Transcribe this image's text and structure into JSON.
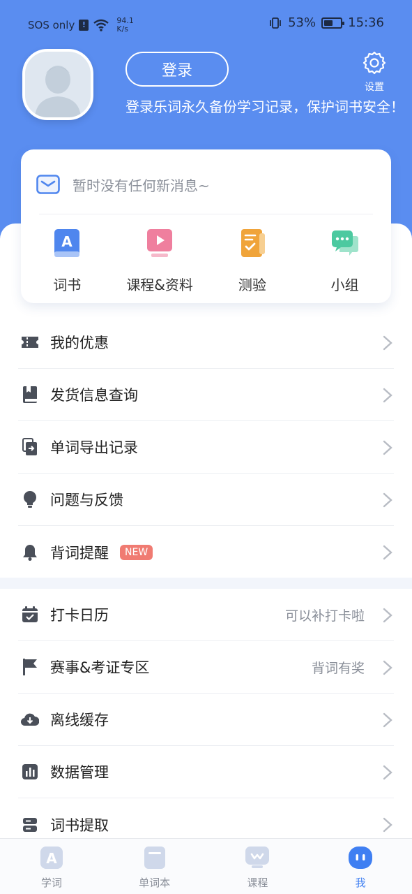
{
  "status_bar": {
    "carrier": "SOS only",
    "net_speed_value": "94.1",
    "net_speed_unit": "K/s",
    "battery": "53%",
    "battery_level": 0.53,
    "time": "15:36"
  },
  "header": {
    "login_label": "登录",
    "login_tip": "登录乐词永久备份学习记录，保护词书安全！",
    "settings_label": "设置"
  },
  "messages": {
    "empty_text": "暂时没有任何新消息~"
  },
  "quick_actions": [
    {
      "label": "词书",
      "icon": "word-book-icon",
      "color": "#4f86ee"
    },
    {
      "label": "课程&资料",
      "icon": "course-play-icon",
      "color": "#ef7f9e"
    },
    {
      "label": "测验",
      "icon": "quiz-icon",
      "color": "#f0a43a"
    },
    {
      "label": "小组",
      "icon": "group-chat-icon",
      "color": "#4cc9a0"
    }
  ],
  "menu_group_1": [
    {
      "label": "我的优惠",
      "icon": "ticket-icon"
    },
    {
      "label": "发货信息查询",
      "icon": "book-icon"
    },
    {
      "label": "单词导出记录",
      "icon": "export-icon"
    },
    {
      "label": "问题与反馈",
      "icon": "bulb-icon"
    },
    {
      "label": "背词提醒",
      "icon": "bell-icon",
      "badge": "NEW"
    }
  ],
  "menu_group_2": [
    {
      "label": "打卡日历",
      "icon": "calendar-icon",
      "hint": "可以补打卡啦"
    },
    {
      "label": "赛事&考证专区",
      "icon": "flag-icon",
      "hint": "背词有奖"
    },
    {
      "label": "离线缓存",
      "icon": "cloud-download-icon"
    },
    {
      "label": "数据管理",
      "icon": "chart-icon"
    },
    {
      "label": "词书提取",
      "icon": "storage-icon"
    }
  ],
  "tabbar": [
    {
      "label": "学词",
      "icon": "learn-tab-icon",
      "active": false
    },
    {
      "label": "单词本",
      "icon": "notebook-tab-icon",
      "active": false
    },
    {
      "label": "课程",
      "icon": "course-tab-icon",
      "active": false
    },
    {
      "label": "我",
      "icon": "me-tab-icon",
      "active": true
    }
  ],
  "colors": {
    "header_bg": "#5a8df0",
    "accent": "#3f7ff2",
    "badge": "#f07b72"
  }
}
